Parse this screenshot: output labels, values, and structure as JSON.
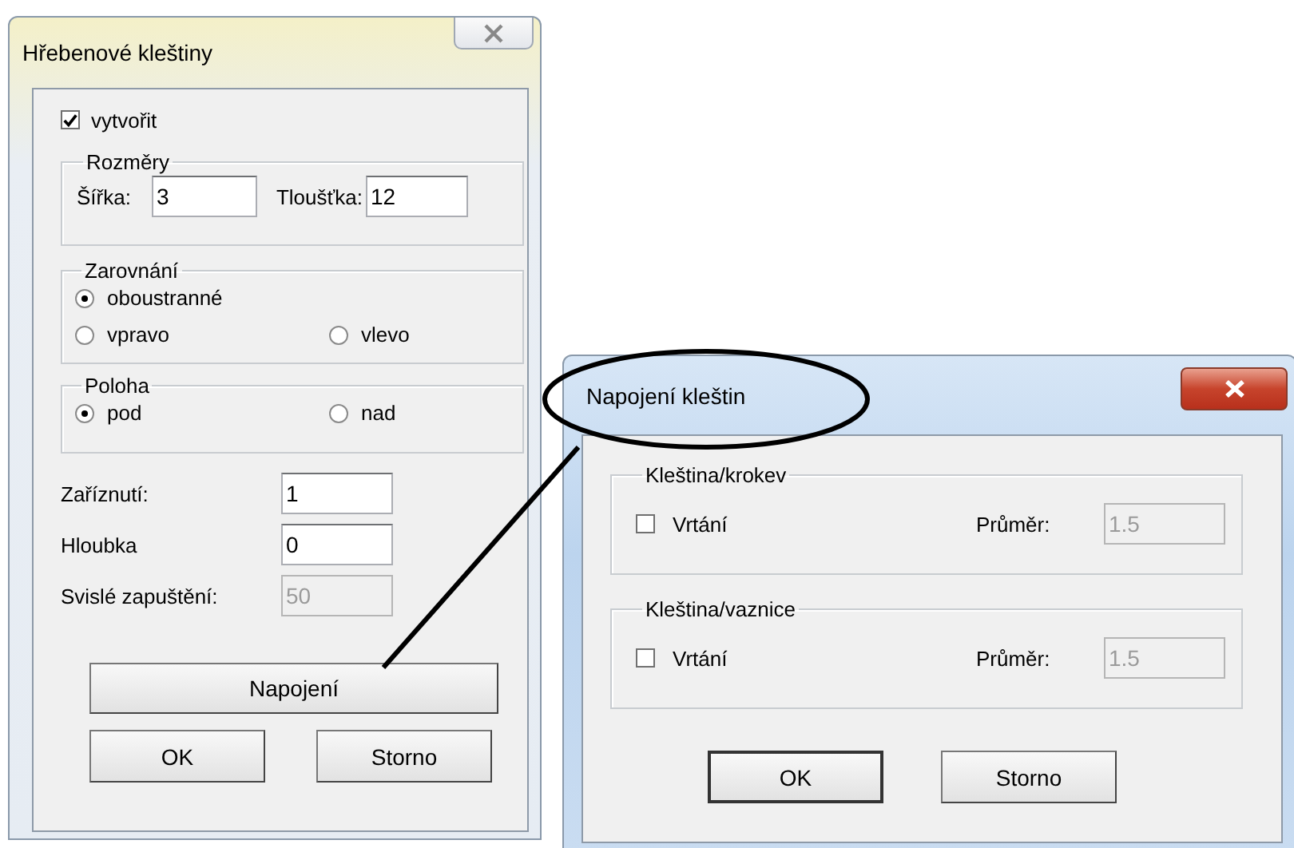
{
  "main_dialog": {
    "title": "Hřebenové kleštiny",
    "create": {
      "label": "vytvořit",
      "checked": true
    },
    "dimensions": {
      "legend": "Rozměry",
      "width": {
        "label": "Šířka:",
        "value": "3"
      },
      "thickness": {
        "label": "Tloušťka:",
        "value": "12"
      }
    },
    "alignment": {
      "legend": "Zarovnání",
      "options": [
        {
          "label": "oboustranné",
          "selected": true
        },
        {
          "label": "vpravo",
          "selected": false
        },
        {
          "label": "vlevo",
          "selected": false
        }
      ]
    },
    "position": {
      "legend": "Poloha",
      "options": [
        {
          "label": "pod",
          "selected": true
        },
        {
          "label": "nad",
          "selected": false
        }
      ]
    },
    "fields": [
      {
        "label": "Zaříznutí:",
        "value": "1",
        "disabled": false
      },
      {
        "label": "Hloubka",
        "value": "0",
        "disabled": false
      },
      {
        "label": "Svislé zapuštění:",
        "value": "50",
        "disabled": true
      }
    ],
    "connect_button": "Napojení",
    "buttons": [
      {
        "label": "OK",
        "default": false
      },
      {
        "label": "Storno",
        "default": false
      }
    ]
  },
  "connection_dialog": {
    "title": "Napojení kleštin",
    "groups": [
      {
        "legend": "Kleština/krokev",
        "drill": {
          "label": "Vrtání",
          "checked": false
        },
        "diameter": {
          "label": "Průměr:",
          "value": "1.5",
          "disabled": true
        }
      },
      {
        "legend": "Kleština/vaznice",
        "drill": {
          "label": "Vrtání",
          "checked": false
        },
        "diameter": {
          "label": "Průměr:",
          "value": "1.5",
          "disabled": true
        }
      }
    ],
    "buttons": [
      {
        "label": "OK",
        "default": true
      },
      {
        "label": "Storno",
        "default": false
      }
    ]
  }
}
